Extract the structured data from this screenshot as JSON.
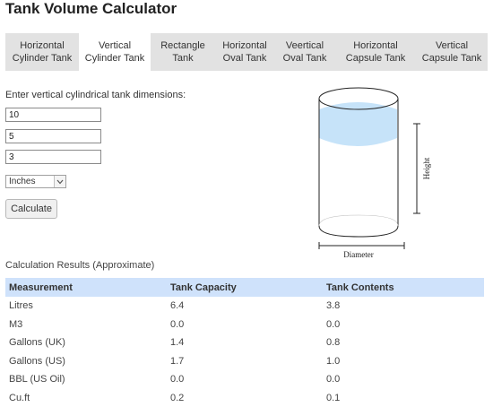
{
  "page": {
    "title": "Tank Volume Calculator"
  },
  "tabs": [
    {
      "label": "Horizontal\nCylinder Tank",
      "active": false
    },
    {
      "label": "Vertical\nCylinder Tank",
      "active": true
    },
    {
      "label": "Rectangle\nTank",
      "active": false
    },
    {
      "label": "Horizontal\nOval Tank",
      "active": false
    },
    {
      "label": "Veertical\nOval Tank",
      "active": false
    },
    {
      "label": "Horizontal\nCapsule Tank",
      "active": false
    },
    {
      "label": "Vertical\nCapsule Tank",
      "active": false
    }
  ],
  "form": {
    "prompt": "Enter vertical cylindrical tank dimensions:",
    "inputs": [
      "10",
      "5",
      "3"
    ],
    "units": "Inches",
    "calculate_label": "Calculate"
  },
  "diagram": {
    "height_label": "Height",
    "diameter_label": "Diameter",
    "liquid_color": "#c6e3f9"
  },
  "results": {
    "title": "Calculation Results (Approximate)",
    "headers": [
      "Measurement",
      "Tank Capacity",
      "Tank Contents"
    ],
    "rows": [
      [
        "Litres",
        "6.4",
        "3.8"
      ],
      [
        "M3",
        "0.0",
        "0.0"
      ],
      [
        "Gallons (UK)",
        "1.4",
        "0.8"
      ],
      [
        "Gallons (US)",
        "1.7",
        "1.0"
      ],
      [
        "BBL (US Oil)",
        "0.0",
        "0.0"
      ],
      [
        "Cu.ft",
        "0.2",
        "0.1"
      ]
    ]
  }
}
